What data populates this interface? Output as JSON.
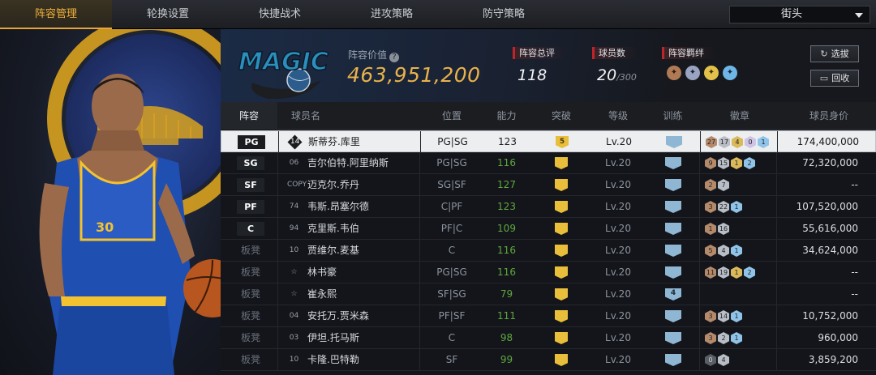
{
  "nav": {
    "tabs": [
      "阵容管理",
      "轮换设置",
      "快捷战术",
      "进攻策略",
      "防守策略"
    ],
    "active_tab": 0,
    "scene_select": "街头"
  },
  "team": {
    "logo_text": "MAGIC",
    "value_label": "阵容价值",
    "value": "463,951,200",
    "overall_label": "阵容总评",
    "overall": "118",
    "players_label": "球员数",
    "players": "20",
    "players_max": "/300",
    "bond_label": "阵容羁绊",
    "bond_icons": [
      "bond-icon-1",
      "bond-icon-2",
      "bond-icon-3",
      "bond-icon-4"
    ],
    "select_btn": "选拔",
    "recycle_btn": "回收"
  },
  "table": {
    "headers": [
      "阵容",
      "球员名",
      "位置",
      "能力",
      "突破",
      "等级",
      "训练",
      "徽章",
      "球员身价"
    ],
    "rows": [
      {
        "slot": "PG",
        "starter": true,
        "num": "14",
        "name": "斯蒂芬.库里",
        "pos": "PG|SG",
        "ability": "123",
        "break": "5",
        "level": "Lv.20",
        "train": "",
        "badges": [
          [
            "b",
            "27"
          ],
          [
            "s",
            "17"
          ],
          [
            "g",
            "4"
          ],
          [
            "p",
            "0"
          ],
          [
            "d",
            "1"
          ]
        ],
        "salary": "174,400,000"
      },
      {
        "slot": "SG",
        "starter": true,
        "num": "06",
        "name": "吉尔伯特.阿里纳斯",
        "pos": "PG|SG",
        "ability": "116",
        "break": "",
        "level": "Lv.20",
        "train": "",
        "badges": [
          [
            "b",
            "9"
          ],
          [
            "s",
            "15"
          ],
          [
            "g",
            "1"
          ],
          [
            "d",
            "2"
          ]
        ],
        "salary": "72,320,000"
      },
      {
        "slot": "SF",
        "starter": true,
        "num": "COPY",
        "name": "迈克尔.乔丹",
        "pos": "SG|SF",
        "ability": "127",
        "break": "",
        "level": "Lv.20",
        "train": "",
        "badges": [
          [
            "b",
            "2"
          ],
          [
            "s",
            "7"
          ]
        ],
        "salary": "--"
      },
      {
        "slot": "PF",
        "starter": true,
        "num": "74",
        "name": "韦斯.昂塞尔德",
        "pos": "C|PF",
        "ability": "123",
        "break": "",
        "level": "Lv.20",
        "train": "",
        "badges": [
          [
            "b",
            "3"
          ],
          [
            "s",
            "22"
          ],
          [
            "d",
            "1"
          ]
        ],
        "salary": "107,520,000"
      },
      {
        "slot": "C",
        "starter": true,
        "num": "94",
        "name": "克里斯.韦伯",
        "pos": "PF|C",
        "ability": "109",
        "break": "",
        "level": "Lv.20",
        "train": "",
        "badges": [
          [
            "b",
            "1"
          ],
          [
            "s",
            "16"
          ]
        ],
        "salary": "55,616,000"
      },
      {
        "slot": "板凳",
        "starter": false,
        "num": "10",
        "name": "贾维尔.麦基",
        "pos": "C",
        "ability": "116",
        "break": "",
        "level": "Lv.20",
        "train": "",
        "badges": [
          [
            "b",
            "5"
          ],
          [
            "s",
            "4"
          ],
          [
            "d",
            "1"
          ]
        ],
        "salary": "34,624,000"
      },
      {
        "slot": "板凳",
        "starter": false,
        "num": "☆",
        "name": "林书豪",
        "pos": "PG|SG",
        "ability": "116",
        "break": "",
        "level": "Lv.20",
        "train": "",
        "badges": [
          [
            "b",
            "11"
          ],
          [
            "s",
            "19"
          ],
          [
            "g",
            "1"
          ],
          [
            "d",
            "2"
          ]
        ],
        "salary": "--"
      },
      {
        "slot": "板凳",
        "starter": false,
        "num": "☆",
        "name": "崔永熙",
        "pos": "SF|SG",
        "ability": "79",
        "break": "",
        "level": "Lv.20",
        "train": "4",
        "badges": [],
        "salary": "--"
      },
      {
        "slot": "板凳",
        "starter": false,
        "num": "04",
        "name": "安托万.贾米森",
        "pos": "PF|SF",
        "ability": "111",
        "break": "",
        "level": "Lv.20",
        "train": "",
        "badges": [
          [
            "b",
            "3"
          ],
          [
            "s",
            "14"
          ],
          [
            "d",
            "1"
          ]
        ],
        "salary": "10,752,000"
      },
      {
        "slot": "板凳",
        "starter": false,
        "num": "03",
        "name": "伊坦.托马斯",
        "pos": "C",
        "ability": "98",
        "break": "",
        "level": "Lv.20",
        "train": "",
        "badges": [
          [
            "b",
            "3"
          ],
          [
            "s",
            "2"
          ],
          [
            "d",
            "1"
          ]
        ],
        "salary": "960,000"
      },
      {
        "slot": "板凳",
        "starter": false,
        "num": "10",
        "name": "卡隆.巴特勒",
        "pos": "SF",
        "ability": "99",
        "break": "",
        "level": "Lv.20",
        "train": "",
        "badges": [
          [
            "k",
            "0"
          ],
          [
            "s",
            "4"
          ]
        ],
        "salary": "3,859,200"
      }
    ]
  },
  "colors": {
    "accent": "#e6a53a",
    "value": "#e9b24a",
    "ability_green": "#5fa83d"
  }
}
